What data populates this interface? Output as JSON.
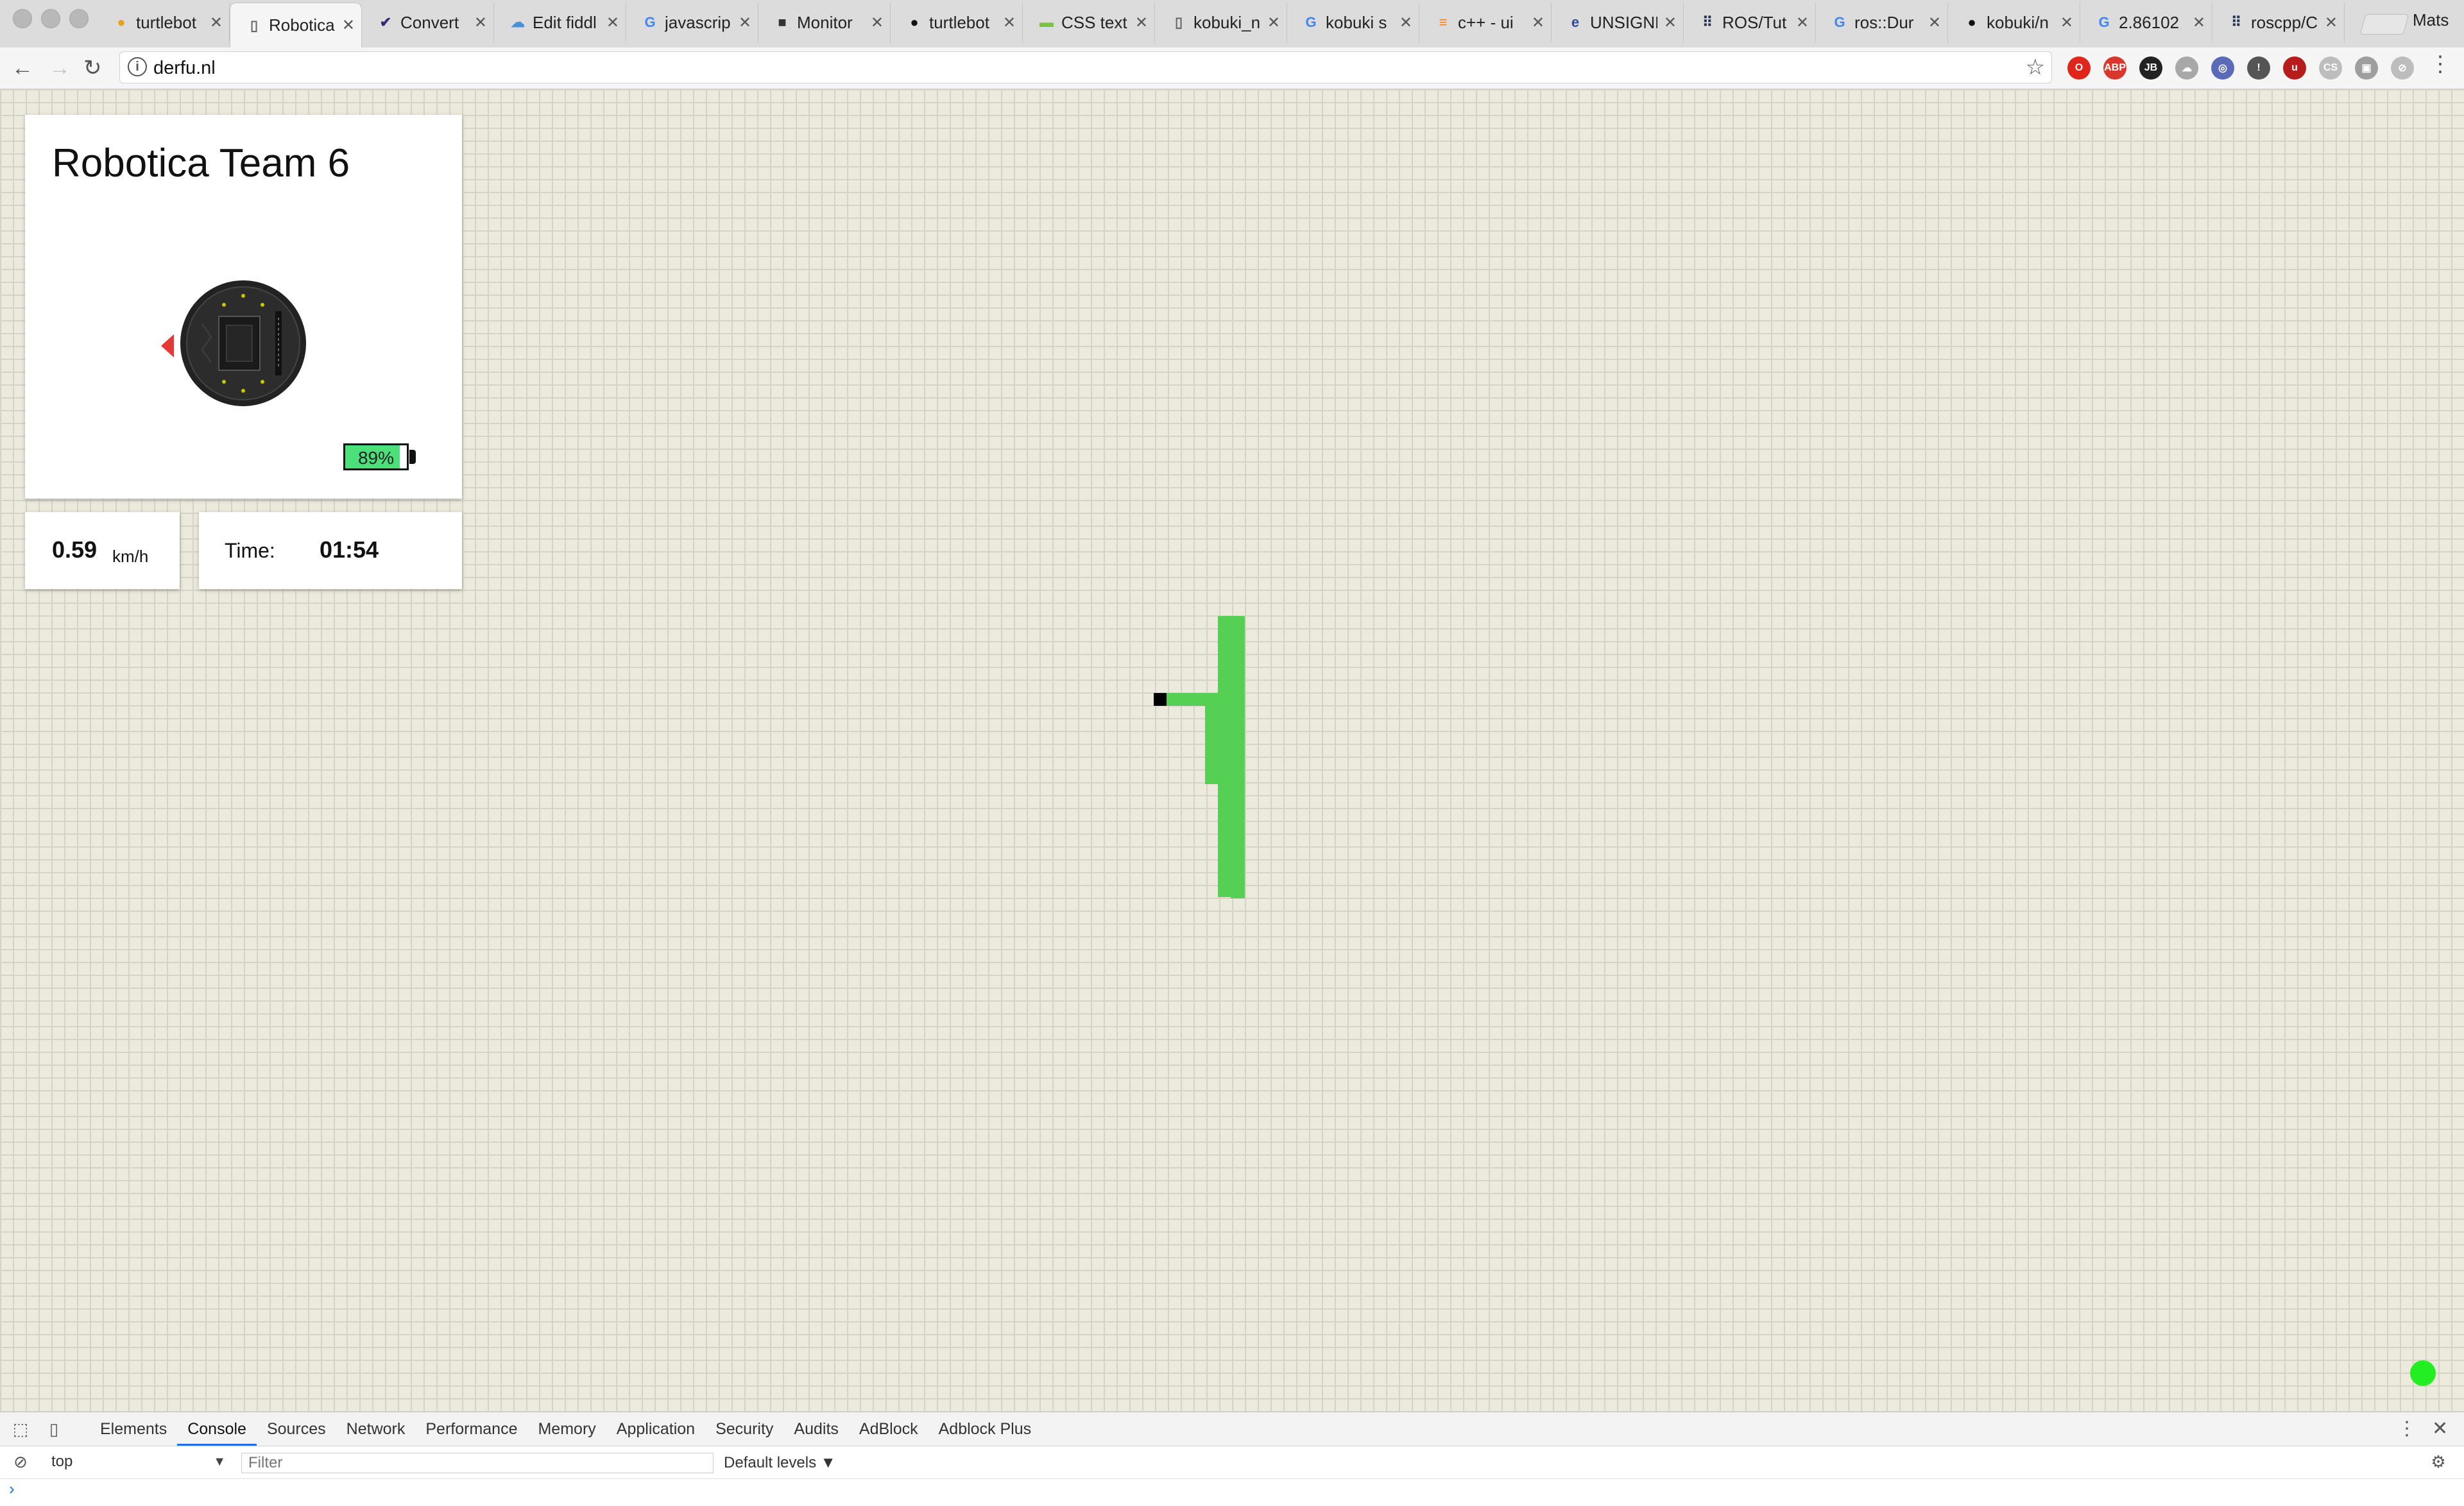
{
  "browser": {
    "tabs": [
      {
        "title": "turtlebot",
        "icon": "penguin-icon",
        "color": "#e6a317",
        "glyph": "●"
      },
      {
        "title": "Robotica",
        "icon": "document-icon",
        "color": "#666666",
        "glyph": "▯",
        "active": true
      },
      {
        "title": "Convert",
        "icon": "checkmark-icon",
        "color": "#3b2a7a",
        "glyph": "✔"
      },
      {
        "title": "Edit fiddl",
        "icon": "cloud-icon",
        "color": "#4a90d9",
        "glyph": "☁"
      },
      {
        "title": "javascrip",
        "icon": "google-icon",
        "color": "#4285f4",
        "glyph": "G"
      },
      {
        "title": "Monitor",
        "icon": "camera-icon",
        "color": "#333333",
        "glyph": "■"
      },
      {
        "title": "turtlebot",
        "icon": "github-icon",
        "color": "#111111",
        "glyph": "●"
      },
      {
        "title": "CSS text",
        "icon": "css-icon",
        "color": "#7cc242",
        "glyph": "▬"
      },
      {
        "title": "kobuki_n",
        "icon": "document-icon",
        "color": "#666666",
        "glyph": "▯"
      },
      {
        "title": "kobuki s",
        "icon": "google-icon",
        "color": "#4285f4",
        "glyph": "G"
      },
      {
        "title": "c++ - ui",
        "icon": "stackoverflow-icon",
        "color": "#f48024",
        "glyph": "≡"
      },
      {
        "title": "UNSIGNE",
        "icon": "globe-icon",
        "color": "#2e4a9e",
        "glyph": "e"
      },
      {
        "title": "ROS/Tut",
        "icon": "ros-icon",
        "color": "#22314e",
        "glyph": "⠿"
      },
      {
        "title": "ros::Dur",
        "icon": "google-icon",
        "color": "#4285f4",
        "glyph": "G"
      },
      {
        "title": "kobuki/n",
        "icon": "github-icon",
        "color": "#111111",
        "glyph": "●"
      },
      {
        "title": "2.86102",
        "icon": "google-icon",
        "color": "#4285f4",
        "glyph": "G"
      },
      {
        "title": "roscpp/C",
        "icon": "ros-icon",
        "color": "#22314e",
        "glyph": "⠿"
      }
    ],
    "close_glyph": "✕",
    "profile_name": "Mats",
    "url": "derfu.nl",
    "extensions": [
      {
        "name": "opera-icon",
        "color": "#e0261b",
        "label": "O"
      },
      {
        "name": "adblock-plus-icon",
        "color": "#d9372b",
        "label": "ABP"
      },
      {
        "name": "jetbrains-icon",
        "color": "#222222",
        "label": "JB"
      },
      {
        "name": "cloud-extension-icon",
        "color": "#a8a8a8",
        "label": "☁"
      },
      {
        "name": "globe-extension-icon",
        "color": "#5a6ab8",
        "label": "◎"
      },
      {
        "name": "info-extension-icon",
        "color": "#555555",
        "label": "!"
      },
      {
        "name": "ublock-icon",
        "color": "#b71c1c",
        "label": "u"
      },
      {
        "name": "cs-extension-icon",
        "color": "#bdbdbd",
        "label": "CS"
      },
      {
        "name": "screenshot-extension-icon",
        "color": "#9e9e9e",
        "label": "▣"
      },
      {
        "name": "compass-extension-icon",
        "color": "#bdbdbd",
        "label": "⊘"
      }
    ]
  },
  "page": {
    "title": "Robotica Team 6",
    "battery_label": "89%",
    "battery_level": 0.89,
    "speed_value": "0.59",
    "speed_unit": "km/h",
    "time_label": "Time:",
    "time_value": "01:54",
    "colors": {
      "background": "#ece9dd",
      "path": "#55d055",
      "battery_fill": "#4ce07a",
      "arrow": "#e53935",
      "status_dot": "#22ee22"
    }
  },
  "devtools": {
    "tabs": [
      "Elements",
      "Console",
      "Sources",
      "Network",
      "Performance",
      "Memory",
      "Application",
      "Security",
      "Audits",
      "AdBlock",
      "Adblock Plus"
    ],
    "active_tab": "Console",
    "context": "top",
    "filter_placeholder": "Filter",
    "levels_label": "Default levels ▼",
    "prompt": "›"
  }
}
